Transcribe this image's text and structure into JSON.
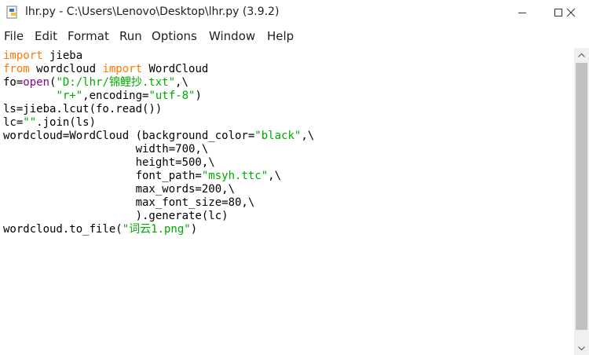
{
  "window": {
    "title": "lhr.py - C:\\Users\\Lenovo\\Desktop\\lhr.py (3.9.2)",
    "icon": "python-file-icon",
    "controls": [
      "minimize-icon",
      "maximize-icon",
      "close-icon"
    ]
  },
  "menu": {
    "items": [
      "File",
      "Edit",
      "Format",
      "Run",
      "Options",
      "Window",
      "Help"
    ]
  },
  "code": {
    "lines": [
      [
        {
          "t": "import",
          "c": "kw"
        },
        {
          "t": " jieba"
        }
      ],
      [
        {
          "t": "from",
          "c": "kw"
        },
        {
          "t": " wordcloud "
        },
        {
          "t": "import",
          "c": "kw"
        },
        {
          "t": " WordCloud"
        }
      ],
      [
        {
          "t": "fo="
        },
        {
          "t": "open",
          "c": "bi"
        },
        {
          "t": "("
        },
        {
          "t": "\"D:/lhr/锦鲤抄.txt\"",
          "c": "str"
        },
        {
          "t": ",\\"
        }
      ],
      [
        {
          "t": "        "
        },
        {
          "t": "\"r+\"",
          "c": "str"
        },
        {
          "t": ",encoding="
        },
        {
          "t": "\"utf-8\"",
          "c": "str"
        },
        {
          "t": ")"
        }
      ],
      [
        {
          "t": "ls=jieba.lcut(fo.read())"
        }
      ],
      [
        {
          "t": "lc="
        },
        {
          "t": "\"\"",
          "c": "str"
        },
        {
          "t": ".join(ls)"
        }
      ],
      [
        {
          "t": "wordcloud=WordCloud (background_color="
        },
        {
          "t": "\"black\"",
          "c": "str"
        },
        {
          "t": ",\\"
        }
      ],
      [
        {
          "t": "                    width=700,\\"
        }
      ],
      [
        {
          "t": "                    height=500,\\"
        }
      ],
      [
        {
          "t": "                    font_path="
        },
        {
          "t": "\"msyh.ttc\"",
          "c": "str"
        },
        {
          "t": ",\\"
        }
      ],
      [
        {
          "t": "                    max_words=200,\\"
        }
      ],
      [
        {
          "t": "                    max_font_size=80,\\"
        }
      ],
      [
        {
          "t": "                    ).generate(lc)"
        }
      ],
      [
        {
          "t": "wordcloud.to_file("
        },
        {
          "t": "\"词云1.png\"",
          "c": "str"
        },
        {
          "t": ")"
        }
      ]
    ]
  },
  "colors": {
    "keyword": "#ff7700",
    "builtin": "#900090",
    "string": "#00aa00",
    "text": "#000000"
  }
}
